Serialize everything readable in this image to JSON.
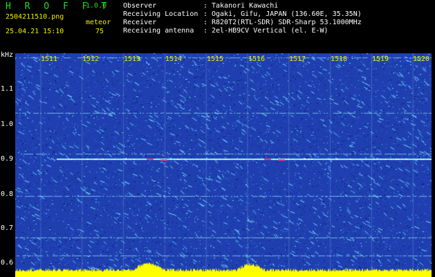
{
  "header": {
    "app_title": "H R O F F T",
    "app_version": "1.0.0",
    "file_name": "2504211510.png",
    "date_time": "25.04.21 15:10",
    "meteor_label": "meteor",
    "meteor_count": "75"
  },
  "info": [
    {
      "label": "Observer",
      "value": "Takanori Kawachi"
    },
    {
      "label": "Receiving Location",
      "value": "Ogaki, Gifu, JAPAN (136.60E, 35.35N)"
    },
    {
      "label": "Receiver",
      "value": "R820T2(RTL-SDR) SDR-Sharp 53.1000MHz"
    },
    {
      "label": "Receiving antenna",
      "value": "2el-HB9CV Vertical (el. E-W)"
    }
  ],
  "spectrogram": {
    "y_unit": "kHz",
    "y_ticks": [
      "1.1",
      "1.0",
      "0.9",
      "0.8",
      "0.7",
      "0.6"
    ],
    "x_ticks": [
      "1511",
      "1512",
      "1513",
      "1514",
      "1515",
      "1516",
      "1517",
      "1518",
      "1519",
      "1520"
    ],
    "colors": {
      "background": "#1f3fb0",
      "noise_light": "#5fd0ff",
      "noise_dark": "#0a1a6a",
      "carrier": "#9ff7ff",
      "meteor": "#ff4060",
      "baseline": "#ffff00"
    }
  }
}
